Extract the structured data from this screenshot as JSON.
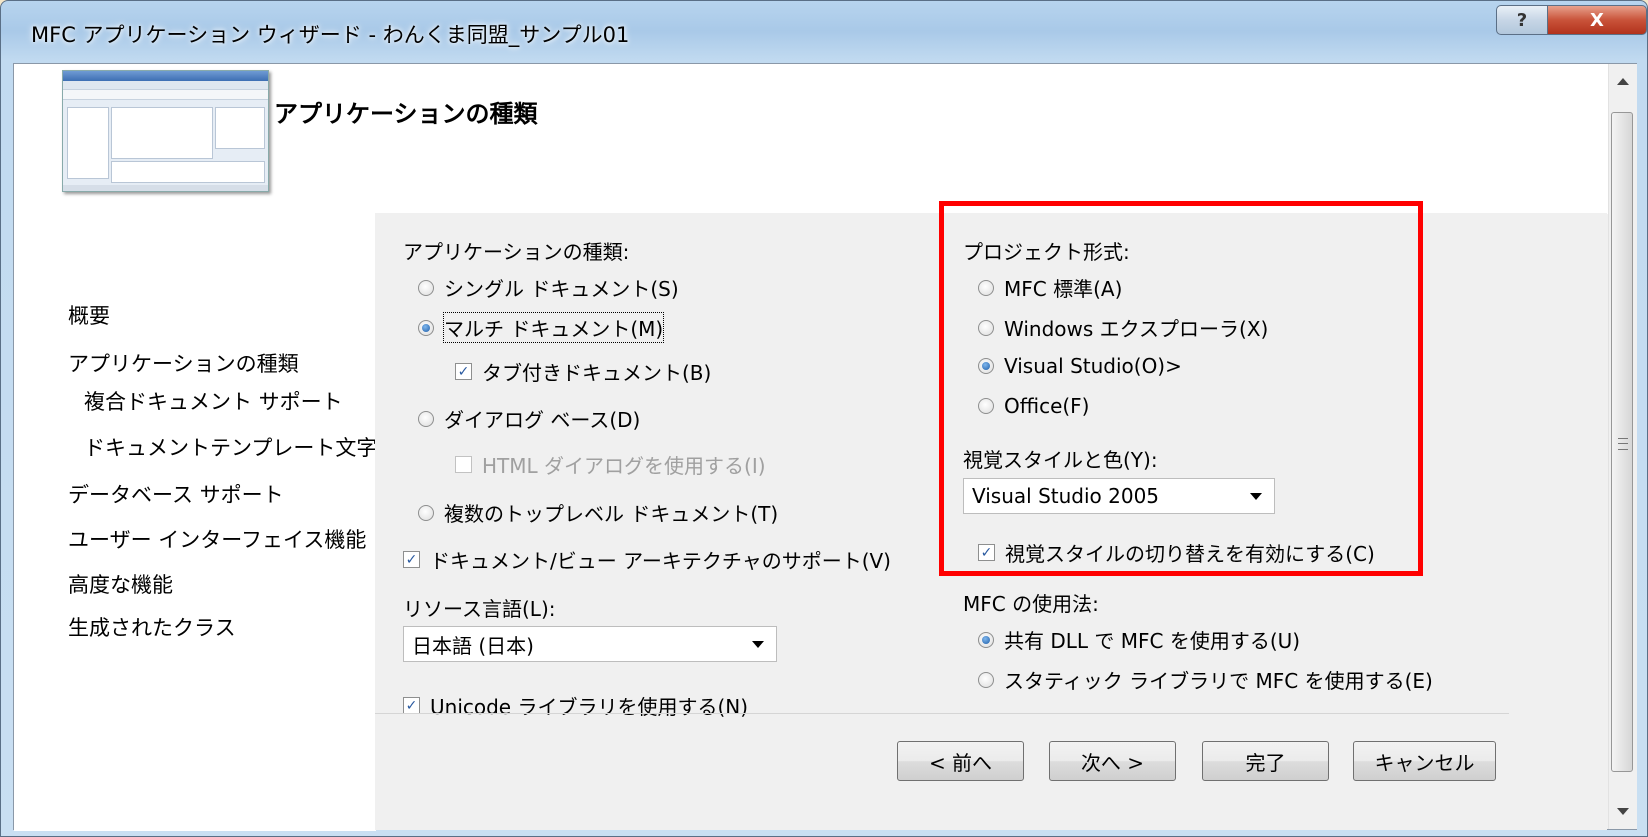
{
  "window": {
    "title": "MFC アプリケーション ウィザード - わんくま同盟_サンプル01",
    "help_label": "?",
    "close_label": "X"
  },
  "header": {
    "title": "アプリケーションの種類"
  },
  "nav": {
    "items": [
      "概要",
      "アプリケーションの種類",
      "複合ドキュメント サポート",
      "ドキュメントテンプレート文字列",
      "データベース サポート",
      "ユーザー インターフェイス機能",
      "高度な機能",
      "生成されたクラス"
    ]
  },
  "app_type": {
    "label": "アプリケーションの種類:",
    "single": "シングル ドキュメント(S)",
    "multi": "マルチ ドキュメント(M)",
    "tabbed": "タブ付きドキュメント(B)",
    "dialog": "ダイアログ ベース(D)",
    "html_dialog": "HTML ダイアログを使用する(I)",
    "toplevel": "複数のトップレベル ドキュメント(T)",
    "selected": "multi"
  },
  "doc_view": "ドキュメント/ビュー アーキテクチャのサポート(V)",
  "resource_lang": {
    "label": "リソース言語(L):",
    "value": "日本語 (日本)"
  },
  "unicode": "Unicode ライブラリを使用する(N)",
  "project_style": {
    "label": "プロジェクト形式:",
    "mfc_std": "MFC 標準(A)",
    "explorer": "Windows エクスプローラ(X)",
    "vs": "Visual Studio(O)>",
    "office": "Office(F)",
    "selected": "vs"
  },
  "visual_style": {
    "label": "視覚スタイルと色(Y):",
    "value": "Visual Studio 2005",
    "switch": "視覚スタイルの切り替えを有効にする(C)"
  },
  "mfc_use": {
    "label": "MFC の使用法:",
    "shared": "共有 DLL で MFC を使用する(U)",
    "static": "スタティック ライブラリで MFC を使用する(E)",
    "selected": "shared"
  },
  "buttons": {
    "prev": "< 前へ",
    "next": "次へ >",
    "finish": "完了",
    "cancel": "キャンセル"
  },
  "colors": {
    "highlight_box": "#ff0000"
  }
}
